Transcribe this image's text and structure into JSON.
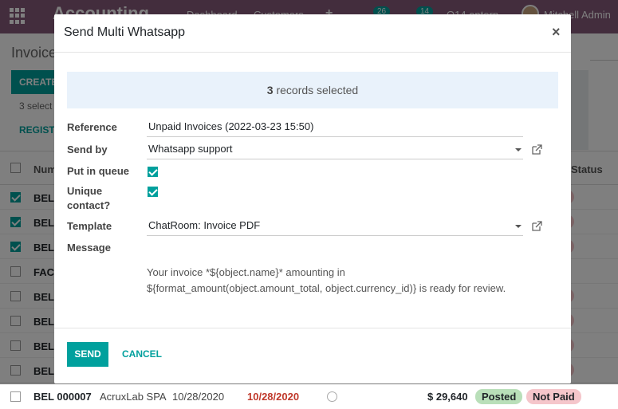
{
  "navbar": {
    "brand": "Accounting",
    "menu": [
      "Dashboard",
      "Customers"
    ],
    "badges": [
      "26",
      "14"
    ],
    "company": "O14 enterp",
    "user": "Mitchell Admin"
  },
  "control": {
    "breadcrumb": "Invoice",
    "create_label": "CREATE",
    "selected_label": "3 select",
    "register_label": "REGIST"
  },
  "list": {
    "header_number": "Num",
    "header_status": "Status",
    "rows": [
      {
        "ref": "BEL",
        "checked": true
      },
      {
        "ref": "BEL",
        "checked": true
      },
      {
        "ref": "BEL",
        "checked": true
      },
      {
        "ref": "FAC",
        "checked": false
      },
      {
        "ref": "BEL",
        "checked": false
      },
      {
        "ref": "BEL",
        "checked": false
      },
      {
        "ref": "BEL",
        "checked": false
      },
      {
        "ref": "BEL",
        "checked": false
      }
    ],
    "last_row": {
      "ref": "BEL 000007",
      "partner": "AcruxLab SPA",
      "date": "10/28/2020",
      "due_date": "10/28/2020",
      "amount": "$ 29,640",
      "state": "Posted",
      "payment": "Not Paid"
    }
  },
  "modal": {
    "title": "Send Multi Whatsapp",
    "records_count": "3",
    "records_text": " records selected",
    "reference_label": "Reference",
    "reference_value": "Unpaid Invoices (2022-03-23 15:50)",
    "send_by_label": "Send by",
    "send_by_value": "Whatsapp support",
    "queue_label": "Put in queue",
    "unique_label_1": "Unique",
    "unique_label_2": "contact?",
    "template_label": "Template",
    "template_value": "ChatRoom: Invoice PDF",
    "message_label": "Message",
    "message_line1": "Your invoice *${object.name}* amounting in",
    "message_line2": "${format_amount(object.amount_total, object.currency_id)} is ready for review.",
    "send_label": "SEND",
    "cancel_label": "CANCEL"
  },
  "colors": {
    "primary": "#875a7b",
    "accent": "#00a09d"
  }
}
